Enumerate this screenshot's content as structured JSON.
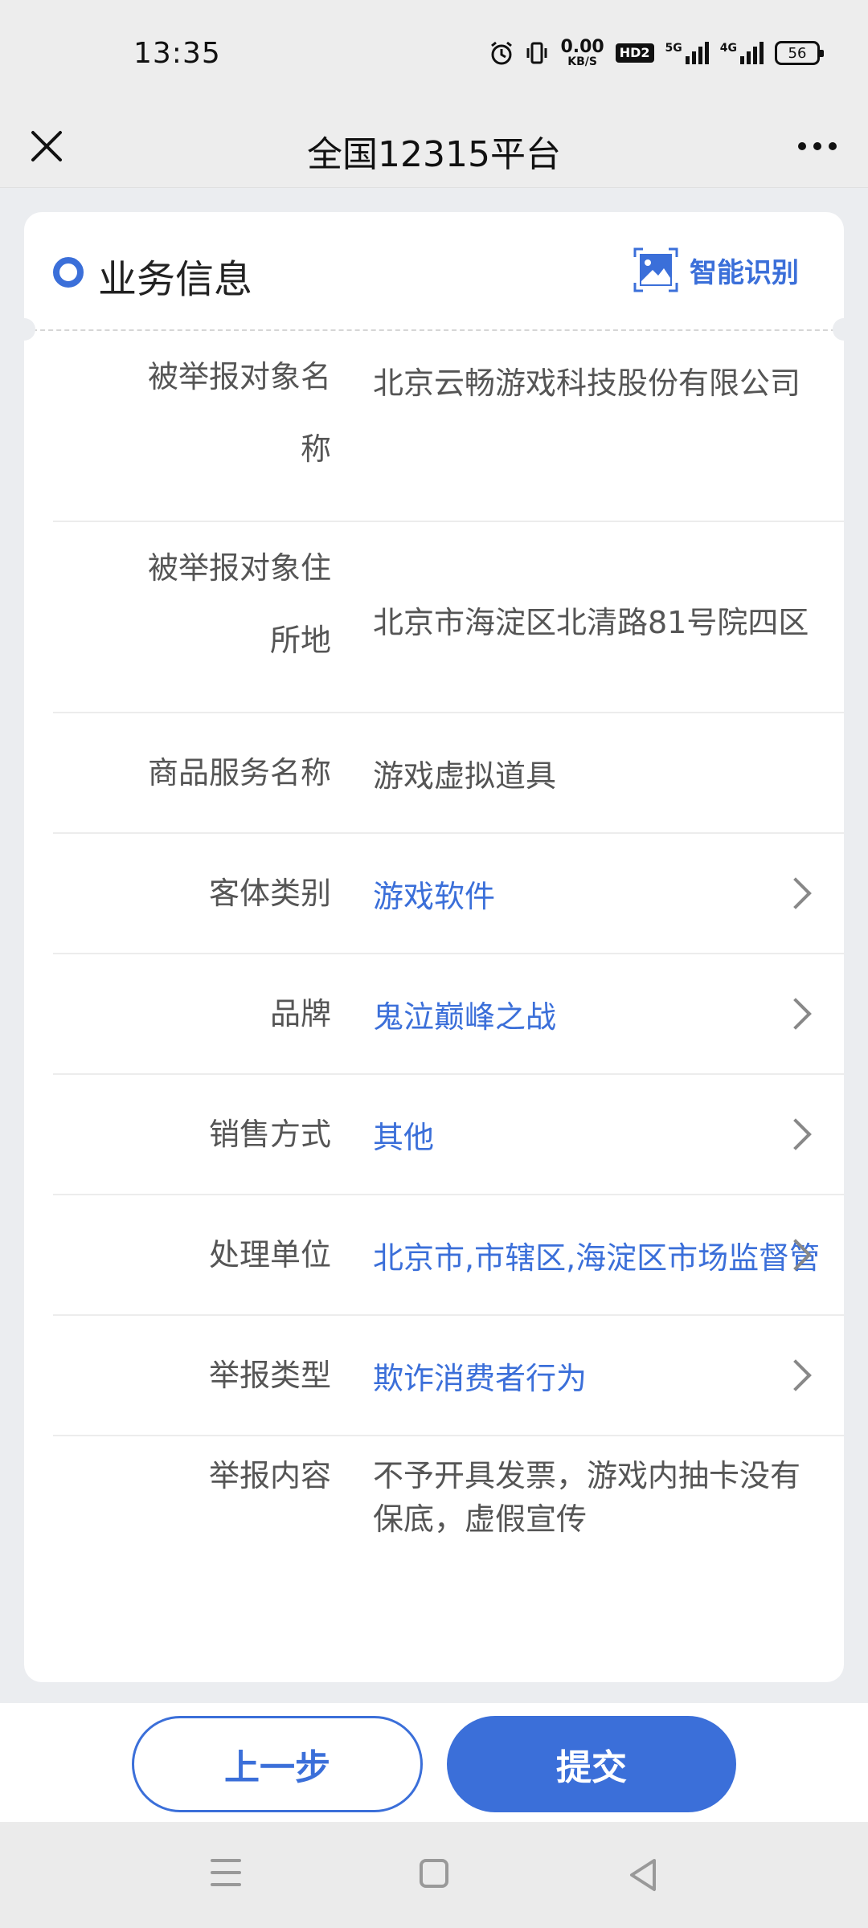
{
  "status_bar": {
    "time": "13:35",
    "net_speed_value": "0.00",
    "net_speed_unit": "KB/S",
    "hd_label": "HD2",
    "sim1_label": "5G",
    "sim2_label": "4G",
    "battery_level": "56",
    "icons": [
      "alarm-icon",
      "vibrate-icon"
    ]
  },
  "nav": {
    "title": "全国12315平台"
  },
  "section": {
    "title": "业务信息",
    "smart_recognize_label": "智能识别",
    "accent_color": "#3b6fd9"
  },
  "form": {
    "rows": [
      {
        "label_line1": "被举报对象名",
        "label_line2": "称",
        "value": "北京云畅游戏科技股份有限公司",
        "is_link": false
      },
      {
        "label_line1": "被举报对象住",
        "label_line2": "所地",
        "value": "北京市海淀区北清路81号院四区",
        "is_link": false
      },
      {
        "label": "商品服务名称",
        "value": "游戏虚拟道具",
        "is_link": false
      },
      {
        "label": "客体类别",
        "value": "游戏软件",
        "is_link": true
      },
      {
        "label": "品牌",
        "value": "鬼泣巅峰之战",
        "is_link": true
      },
      {
        "label": "销售方式",
        "value": "其他",
        "is_link": true
      },
      {
        "label": "处理单位",
        "value": "北京市,市辖区,海淀区市场监督管理局",
        "is_link": true
      },
      {
        "label": "举报类型",
        "value": "欺诈消费者行为",
        "is_link": true
      },
      {
        "label": "举报内容",
        "value_line1": "不予开具发票，游戏内抽卡没有",
        "value_line2": "保底，虚假宣传",
        "is_link": false
      }
    ]
  },
  "footer": {
    "prev_label": "上一步",
    "submit_label": "提交"
  }
}
